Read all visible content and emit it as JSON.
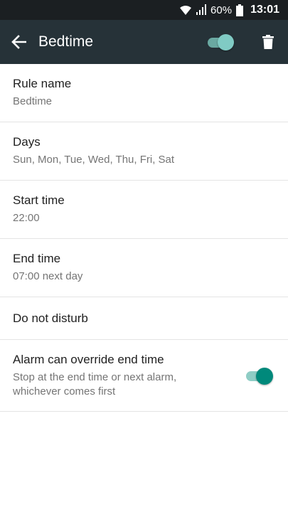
{
  "status_bar": {
    "battery_percent": "60%",
    "time": "13:01",
    "icons": [
      "wifi-icon",
      "signal-icon",
      "battery-icon"
    ]
  },
  "app_bar": {
    "title": "Bedtime",
    "back_icon": "arrow-left-icon",
    "rule_enabled": true,
    "delete_icon": "trash-icon",
    "background_color": "#263238"
  },
  "settings": {
    "rule_name": {
      "title": "Rule name",
      "value": "Bedtime"
    },
    "days": {
      "title": "Days",
      "value": "Sun, Mon, Tue, Wed, Thu, Fri, Sat"
    },
    "start_time": {
      "title": "Start time",
      "value": "22:00"
    },
    "end_time": {
      "title": "End time",
      "value": "07:00 next day"
    },
    "do_not_disturb": {
      "title": "Do not disturb"
    },
    "alarm_override": {
      "title": "Alarm can override end time",
      "description": "Stop at the end time or next alarm, whichever comes first",
      "enabled": true
    }
  },
  "accent_color": "#00897b"
}
